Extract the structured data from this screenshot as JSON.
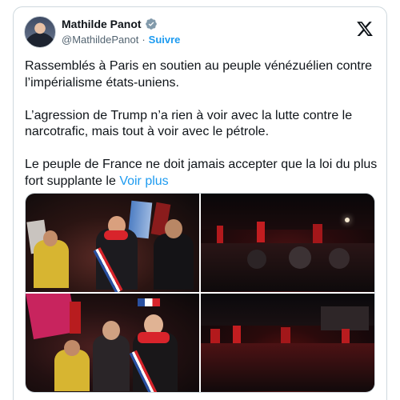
{
  "author": {
    "name": "Mathilde Panot",
    "handle": "@MathildePanot",
    "separator": "·",
    "follow_label": "Suivre"
  },
  "icons": {
    "verified": "verified-badge-icon",
    "brand": "x-logo-icon"
  },
  "post": {
    "paragraphs": [
      "Rassemblés à Paris en soutien au peuple vénézuélien contre l’impérialisme états-uniens.",
      "L’agression de Trump n’a rien à voir avec la lutte contre le narcotrafic, mais tout à voir avec le pétrole."
    ],
    "last_paragraph": "Le peuple de France ne doit jamais accepter que la loi du plus fort supplante le",
    "see_more": "Voir plus"
  },
  "colors": {
    "link": "#1d9bf0",
    "text": "#0f1419",
    "muted": "#536471",
    "border": "#cfd9de"
  },
  "media": {
    "count": 4,
    "descriptions": [
      "rally-photo-1",
      "rally-photo-2",
      "rally-photo-3",
      "rally-photo-4"
    ]
  }
}
